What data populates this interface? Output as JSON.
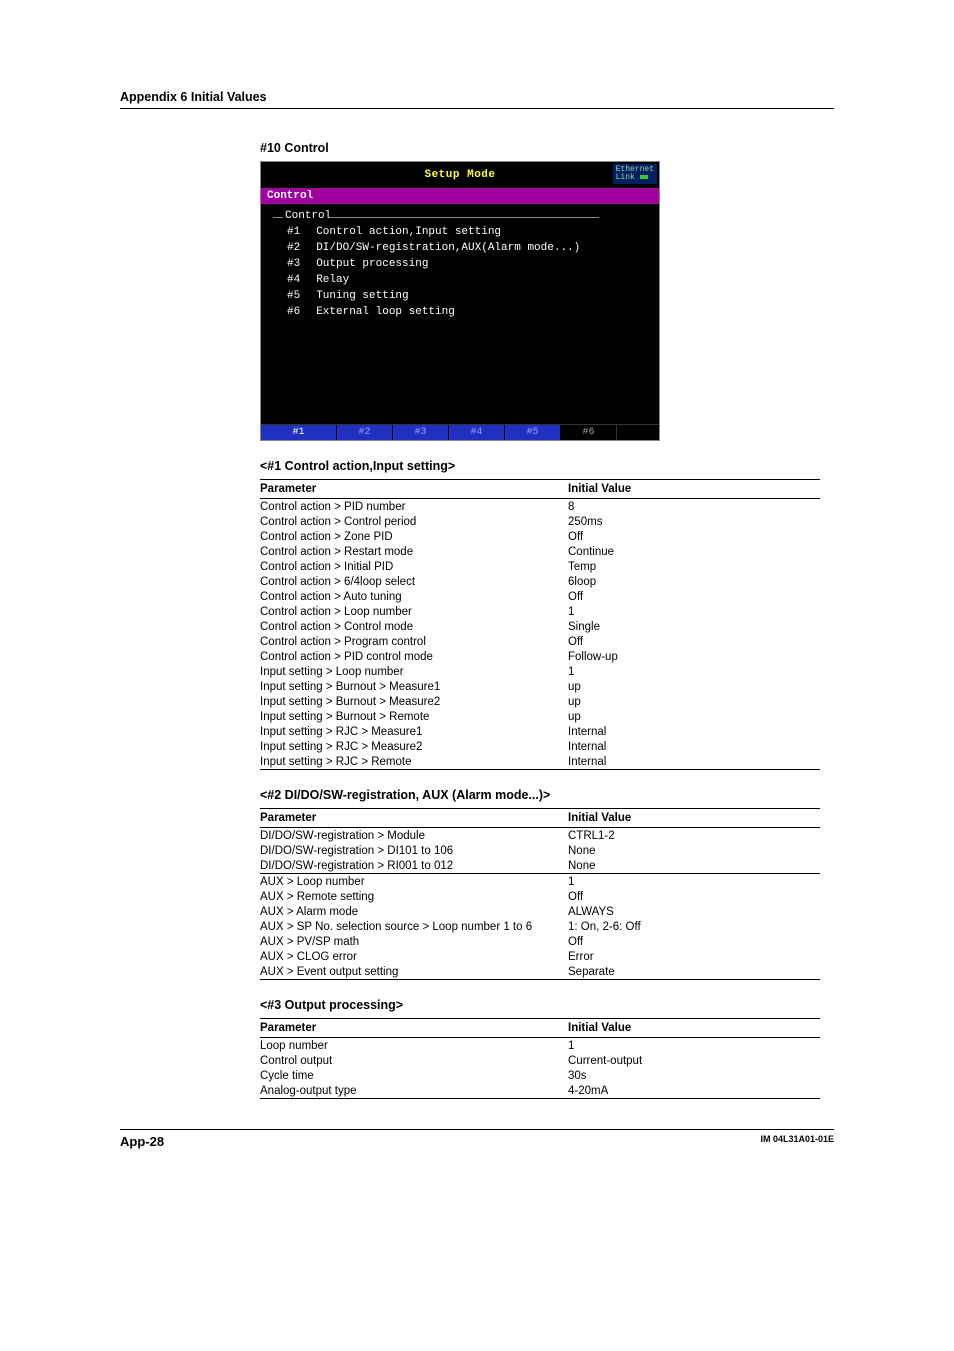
{
  "header": {
    "appendix_title": "Appendix 6  Initial Values"
  },
  "section": {
    "heading": "#10 Control"
  },
  "screenshot": {
    "title": "Setup Mode",
    "eth_label1": "Ethernet",
    "eth_label2": "Link",
    "modebar": "Control",
    "group_label": "Control",
    "items": [
      {
        "id": "#1",
        "text": "Control action,Input setting"
      },
      {
        "id": "#2",
        "text": "DI/DO/SW-registration,AUX(Alarm mode...)"
      },
      {
        "id": "#3",
        "text": "Output processing"
      },
      {
        "id": "#4",
        "text": "Relay"
      },
      {
        "id": "#5",
        "text": "Tuning setting"
      },
      {
        "id": "#6",
        "text": "External loop setting"
      }
    ],
    "tabs": [
      "#1",
      "#2",
      "#3",
      "#4",
      "#5",
      "#6"
    ]
  },
  "tables": {
    "t1": {
      "heading": "<#1 Control action,Input setting>",
      "col_param": "Parameter",
      "col_value": "Initial Value",
      "rows": [
        [
          "Control action > PID number",
          "8"
        ],
        [
          "Control action > Control period",
          "250ms"
        ],
        [
          "Control action > Zone PID",
          "Off"
        ],
        [
          "Control action > Restart mode",
          "Continue"
        ],
        [
          "Control action > Initial PID",
          "Temp"
        ],
        [
          "Control action > 6/4loop select",
          "6loop"
        ],
        [
          "Control action > Auto tuning",
          "Off"
        ],
        [
          "Control action > Loop number",
          "1"
        ],
        [
          "Control action > Control mode",
          "Single"
        ],
        [
          "Control action > Program control",
          "Off"
        ],
        [
          "Control action > PID control mode",
          "Follow-up"
        ],
        [
          "Input setting > Loop number",
          "1"
        ],
        [
          "Input setting > Burnout > Measure1",
          "up"
        ],
        [
          "Input setting > Burnout > Measure2",
          "up"
        ],
        [
          "Input setting > Burnout > Remote",
          "up"
        ],
        [
          "Input setting > RJC > Measure1",
          "Internal"
        ],
        [
          "Input setting > RJC > Measure2",
          "Internal"
        ],
        [
          "Input setting > RJC > Remote",
          "Internal"
        ]
      ]
    },
    "t2": {
      "heading": "<#2 DI/DO/SW-registration, AUX (Alarm mode...)>",
      "col_param": "Parameter",
      "col_value": "Initial Value",
      "group1": [
        [
          "DI/DO/SW-registration > Module",
          "CTRL1-2"
        ],
        [
          "DI/DO/SW-registration > DI101 to 106",
          "None"
        ],
        [
          "DI/DO/SW-registration > RI001 to 012",
          "None"
        ]
      ],
      "group2": [
        [
          "AUX > Loop number",
          "1"
        ],
        [
          "AUX > Remote setting",
          "Off"
        ],
        [
          "AUX > Alarm mode",
          "ALWAYS"
        ],
        [
          "AUX > SP No. selection source > Loop number 1 to 6",
          "1: On, 2-6: Off"
        ],
        [
          "AUX > PV/SP math",
          "Off"
        ],
        [
          "AUX > CLOG error",
          "Error"
        ],
        [
          "AUX > Event output setting",
          "Separate"
        ]
      ]
    },
    "t3": {
      "heading": "<#3 Output processing>",
      "col_param": "Parameter",
      "col_value": "Initial Value",
      "rows": [
        [
          "Loop number",
          "1"
        ],
        [
          "Control output",
          "Current-output"
        ],
        [
          "Cycle time",
          "30s"
        ],
        [
          "Analog-output type",
          "4-20mA"
        ]
      ]
    }
  },
  "footer": {
    "left": "App-28",
    "right": "IM 04L31A01-01E"
  }
}
